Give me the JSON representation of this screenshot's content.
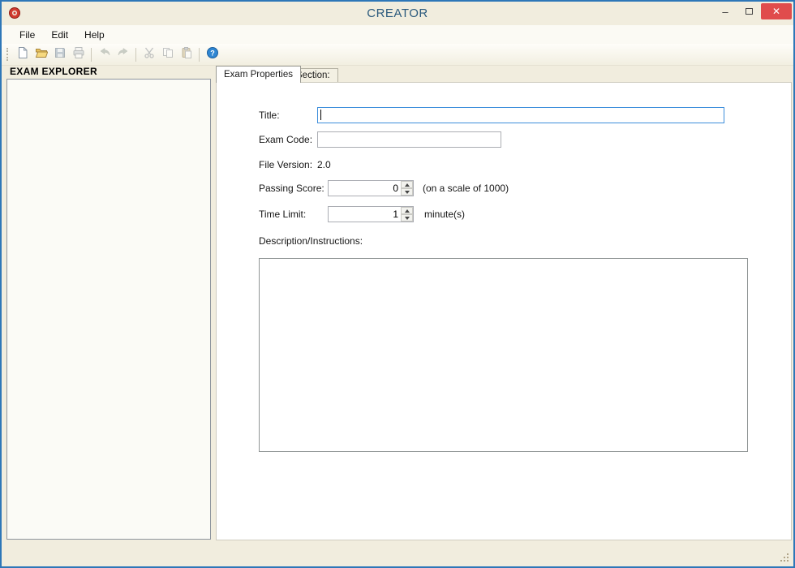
{
  "window": {
    "title": "CREATOR",
    "minimize_glyph": "–",
    "close_glyph": "✕"
  },
  "menu": {
    "items": [
      {
        "label": "File"
      },
      {
        "label": "Edit"
      },
      {
        "label": "Help"
      }
    ]
  },
  "toolbar": {
    "icons": [
      "new-icon",
      "open-icon",
      "save-icon",
      "print-icon",
      "undo-icon",
      "redo-icon",
      "cut-icon",
      "copy-icon",
      "paste-icon",
      "help-icon"
    ]
  },
  "explorer": {
    "title": "EXAM EXPLORER"
  },
  "tabs": [
    {
      "label": "Exam Properties",
      "active": true
    },
    {
      "label": "Section:",
      "active": false
    }
  ],
  "form": {
    "title": {
      "label": "Title:",
      "value": ""
    },
    "exam_code": {
      "label": "Exam Code:",
      "value": ""
    },
    "file_version": {
      "label": "File Version:",
      "value": "2.0"
    },
    "passing_score": {
      "label": "Passing Score:",
      "value": "0",
      "suffix": "(on a scale of 1000)"
    },
    "time_limit": {
      "label": "Time Limit:",
      "value": "1",
      "suffix": "minute(s)"
    },
    "description": {
      "label": "Description/Instructions:",
      "value": ""
    }
  },
  "colors": {
    "window_border": "#2e77b8",
    "titlebar_bg": "#f1edde",
    "title_text": "#2b5a7d",
    "close_button": "#e04c4c",
    "client_bg": "#f1edde",
    "focus_border": "#3d8edb",
    "help_accent": "#2f86d2"
  }
}
